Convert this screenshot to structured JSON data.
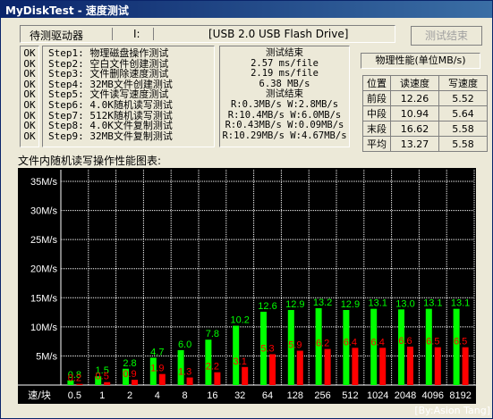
{
  "window": {
    "title": "MyDiskTest - 速度测试"
  },
  "drive_bar": {
    "label": "待测驱动器",
    "letter": "I:",
    "drive": "[USB 2.0 USB Flash Drive]"
  },
  "stop_button": {
    "label": "测试结束"
  },
  "status_col": [
    "OK",
    "OK",
    "OK",
    "OK",
    "OK",
    "OK",
    "OK",
    "OK",
    "OK"
  ],
  "steps": [
    "Step1: 物理磁盘操作测试",
    "Step2: 空白文件创建测试",
    "Step3: 文件删除速度测试",
    "Step4: 32MB文件创建测试",
    "Step5: 文件读写速度测试",
    "Step6: 4.0K随机读写测试",
    "Step7: 512K随机读写测试",
    "Step8: 4.0K文件复制测试",
    "Step9: 32MB文件复制测试"
  ],
  "results": [
    "测试结束",
    "2.57 ms/file",
    "2.19 ms/file",
    "6.38 MB/s",
    "测试结束",
    "R:0.3MB/s W:2.8MB/s",
    "R:10.4MB/s W:6.0MB/s",
    "R:0.43MB/s W:0.09MB/s",
    "R:10.29MB/s W:4.67MB/s"
  ],
  "performance": {
    "title": "物理性能(单位MB/s)",
    "headers": [
      "位置",
      "读速度",
      "写速度"
    ],
    "rows": [
      {
        "pos": "前段",
        "read": "12.26",
        "write": "5.52"
      },
      {
        "pos": "中段",
        "read": "10.94",
        "write": "5.64"
      },
      {
        "pos": "末段",
        "read": "16.62",
        "write": "5.58"
      },
      {
        "pos": "平均",
        "read": "13.27",
        "write": "5.58"
      }
    ]
  },
  "chart_heading": "文件内随机读写操作性能图表:",
  "chart_data": {
    "type": "bar",
    "categories": [
      "0.5",
      "1",
      "2",
      "4",
      "8",
      "16",
      "32",
      "64",
      "128",
      "256",
      "512",
      "1024",
      "2048",
      "4096",
      "8192"
    ],
    "series": [
      {
        "values": [
          0.8,
          1.5,
          2.8,
          4.7,
          6.0,
          7.8,
          10.2,
          12.6,
          12.9,
          13.2,
          12.9,
          13.1,
          13.0,
          13.1,
          13.1
        ],
        "color": "#00ff00"
      },
      {
        "values": [
          0.2,
          0.5,
          0.9,
          1.9,
          1.3,
          2.2,
          3.1,
          5.3,
          5.9,
          6.2,
          6.4,
          6.4,
          6.6,
          6.5,
          6.5
        ],
        "color": "#ff0000"
      }
    ],
    "ylim": [
      0,
      37
    ],
    "yticks": [
      {
        "v": 5,
        "label": "5M/s"
      },
      {
        "v": 10,
        "label": "10M/s"
      },
      {
        "v": 15,
        "label": "15M/s"
      },
      {
        "v": 20,
        "label": "20M/s"
      },
      {
        "v": 25,
        "label": "25M/s"
      },
      {
        "v": 30,
        "label": "30M/s"
      },
      {
        "v": 35,
        "label": "35M/s"
      }
    ],
    "corner_label": "速/块",
    "grid": true
  },
  "credit": "[By:Asion Tang]",
  "colors": {
    "titlebar": "#0a246a",
    "chart_bg": "#000000",
    "grid": "#ffffff"
  }
}
